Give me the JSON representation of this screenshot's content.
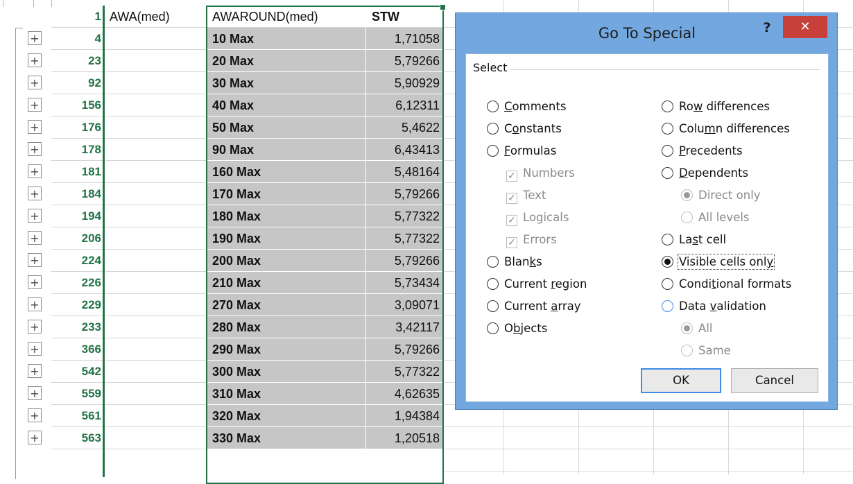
{
  "sheet": {
    "header": {
      "rownum": "1",
      "colA": "AWA(med)",
      "colB": "AWAROUND(med)",
      "colC": "STW"
    },
    "rows": [
      {
        "rownum": "4",
        "b": "10 Max",
        "c": "1,71058"
      },
      {
        "rownum": "23",
        "b": "20 Max",
        "c": "5,79266"
      },
      {
        "rownum": "92",
        "b": "30 Max",
        "c": "5,90929"
      },
      {
        "rownum": "156",
        "b": "40 Max",
        "c": "6,12311"
      },
      {
        "rownum": "176",
        "b": "50 Max",
        "c": "5,4622"
      },
      {
        "rownum": "178",
        "b": "90 Max",
        "c": "6,43413"
      },
      {
        "rownum": "181",
        "b": "160 Max",
        "c": "5,48164"
      },
      {
        "rownum": "184",
        "b": "170 Max",
        "c": "5,79266"
      },
      {
        "rownum": "194",
        "b": "180 Max",
        "c": "5,77322"
      },
      {
        "rownum": "206",
        "b": "190 Max",
        "c": "5,77322"
      },
      {
        "rownum": "224",
        "b": "200 Max",
        "c": "5,79266"
      },
      {
        "rownum": "226",
        "b": "210 Max",
        "c": "5,73434"
      },
      {
        "rownum": "229",
        "b": "270 Max",
        "c": "3,09071"
      },
      {
        "rownum": "233",
        "b": "280 Max",
        "c": "3,42117"
      },
      {
        "rownum": "366",
        "b": "290 Max",
        "c": "5,79266"
      },
      {
        "rownum": "542",
        "b": "300 Max",
        "c": "5,77322"
      },
      {
        "rownum": "559",
        "b": "310 Max",
        "c": "4,62635"
      },
      {
        "rownum": "561",
        "b": "320 Max",
        "c": "1,94384"
      },
      {
        "rownum": "563",
        "b": "330 Max",
        "c": "1,20518"
      }
    ],
    "expand_glyph": "+"
  },
  "dialog": {
    "title": "Go To Special",
    "help_glyph": "?",
    "close_glyph": "✕",
    "group_label": "Select",
    "left_options": [
      {
        "pre": "",
        "ul": "C",
        "post": "omments"
      },
      {
        "pre": "C",
        "ul": "o",
        "post": "nstants"
      },
      {
        "pre": "",
        "ul": "F",
        "post": "ormulas"
      },
      {
        "pre": "Blan",
        "ul": "k",
        "post": "s"
      },
      {
        "pre": "Current ",
        "ul": "r",
        "post": "egion"
      },
      {
        "pre": "Current ",
        "ul": "a",
        "post": "rray"
      },
      {
        "pre": "O",
        "ul": "b",
        "post": "jects"
      }
    ],
    "formula_checks": [
      "Numbers",
      "Text",
      "Logicals",
      "Errors"
    ],
    "check_glyph": "✓",
    "right_options": [
      {
        "pre": "Ro",
        "ul": "w",
        "post": " differences"
      },
      {
        "pre": "Colu",
        "ul": "m",
        "post": "n differences"
      },
      {
        "pre": "",
        "ul": "P",
        "post": "recedents"
      },
      {
        "pre": "",
        "ul": "D",
        "post": "ependents"
      },
      {
        "pre": "La",
        "ul": "s",
        "post": "t cell"
      },
      {
        "pre": "Visible cells onl",
        "ul": "y",
        "post": ""
      },
      {
        "pre": "Condi",
        "ul": "t",
        "post": "ional formats"
      },
      {
        "pre": "Data ",
        "ul": "v",
        "post": "alidation"
      }
    ],
    "dependents_sub": [
      "Direct only",
      "All levels"
    ],
    "validation_sub": [
      "All",
      "Same"
    ],
    "ok_label": "OK",
    "cancel_label": "Cancel"
  }
}
